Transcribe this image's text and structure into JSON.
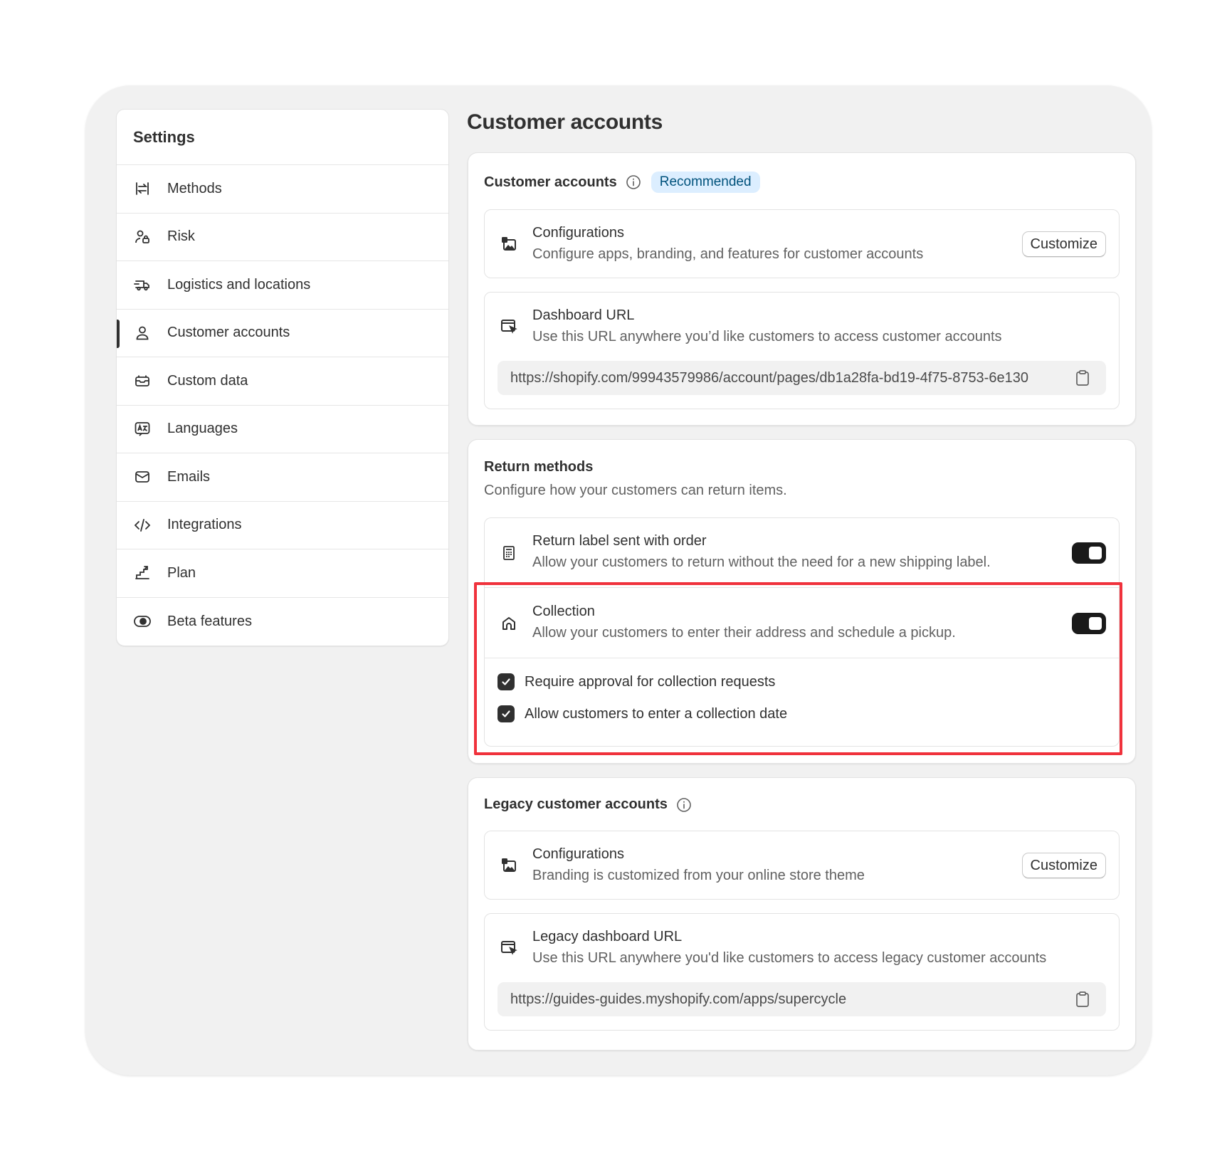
{
  "sidebar": {
    "title": "Settings",
    "items": [
      {
        "label": "Methods",
        "icon": "arrows-swap-icon"
      },
      {
        "label": "Risk",
        "icon": "person-lock-icon"
      },
      {
        "label": "Logistics and locations",
        "icon": "truck-icon"
      },
      {
        "label": "Customer accounts",
        "icon": "person-icon",
        "active": true
      },
      {
        "label": "Custom data",
        "icon": "database-icon"
      },
      {
        "label": "Languages",
        "icon": "translate-icon"
      },
      {
        "label": "Emails",
        "icon": "envelope-icon"
      },
      {
        "label": "Integrations",
        "icon": "code-icon"
      },
      {
        "label": "Plan",
        "icon": "stairs-icon"
      },
      {
        "label": "Beta features",
        "icon": "toggle-icon"
      }
    ]
  },
  "main": {
    "title": "Customer accounts",
    "customer_accounts": {
      "title": "Customer accounts",
      "badge": "Recommended",
      "configurations": {
        "title": "Configurations",
        "description": "Configure apps, branding, and features for customer accounts",
        "button": "Customize"
      },
      "dashboard": {
        "title": "Dashboard URL",
        "description": "Use this URL anywhere you’d like customers to access customer accounts",
        "url": "https://shopify.com/99943579986/account/pages/db1a28fa-bd19-4f75-8753-6e130"
      }
    },
    "return_methods": {
      "title": "Return methods",
      "description": "Configure how your customers can return items.",
      "return_label": {
        "title": "Return label sent with order",
        "description": "Allow your customers to return without the need for a new shipping label.",
        "enabled": true
      },
      "collection": {
        "title": "Collection",
        "description": "Allow your customers to enter their address and schedule a pickup.",
        "enabled": true,
        "options": [
          {
            "label": "Require approval for collection requests",
            "checked": true
          },
          {
            "label": "Allow customers to enter a collection date",
            "checked": true
          }
        ]
      }
    },
    "legacy": {
      "title": "Legacy customer accounts",
      "configurations": {
        "title": "Configurations",
        "description": "Branding is customized from your online store theme",
        "button": "Customize"
      },
      "dashboard": {
        "title": "Legacy dashboard URL",
        "description": "Use this URL anywhere you'd like customers to access legacy customer accounts",
        "url": "https://guides-guides.myshopify.com/apps/supercycle"
      }
    }
  },
  "colors": {
    "frame_bg": "#f1f1f1",
    "text": "#303030",
    "badge_bg": "#dceeff",
    "highlight": "#f0323c"
  }
}
